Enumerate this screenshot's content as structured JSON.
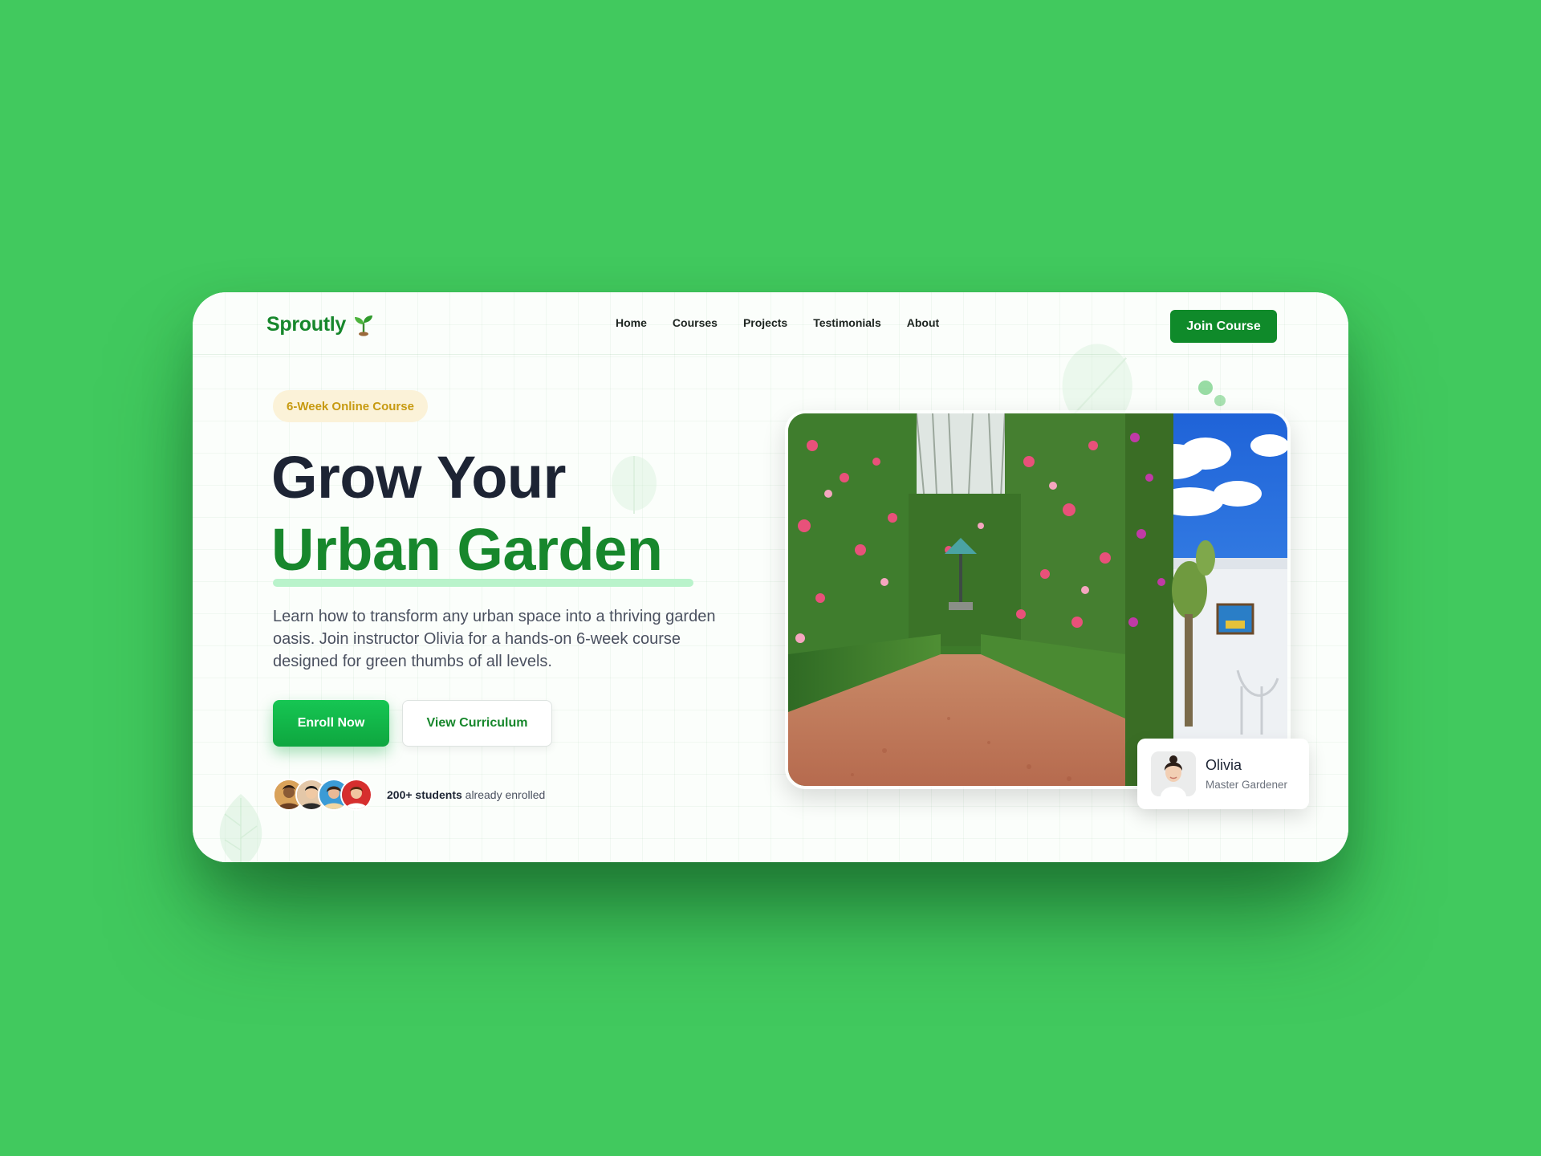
{
  "brand": {
    "name": "Sproutly",
    "logo_icon": "sprout-icon",
    "primary_color": "#17872c",
    "accent_color": "#0ea63f",
    "badge_color": "#c79a10"
  },
  "nav": {
    "items": [
      {
        "label": "Home"
      },
      {
        "label": "Courses"
      },
      {
        "label": "Projects"
      },
      {
        "label": "Testimonials"
      },
      {
        "label": "About"
      }
    ],
    "cta_label": "Join Course"
  },
  "hero": {
    "badge": "6-Week Online Course",
    "title_line1": "Grow Your",
    "title_line2": "Urban Garden",
    "description": "Learn how to transform any urban space into a thriving garden oasis. Join instructor Olivia for a hands-on 6-week course designed for green thumbs of all levels.",
    "primary_button": "Enroll Now",
    "secondary_button": "View Curriculum",
    "students_count": "200+ students",
    "students_suffix": "already enrolled"
  },
  "instructor": {
    "name": "Olivia",
    "role": "Master Gardener"
  }
}
